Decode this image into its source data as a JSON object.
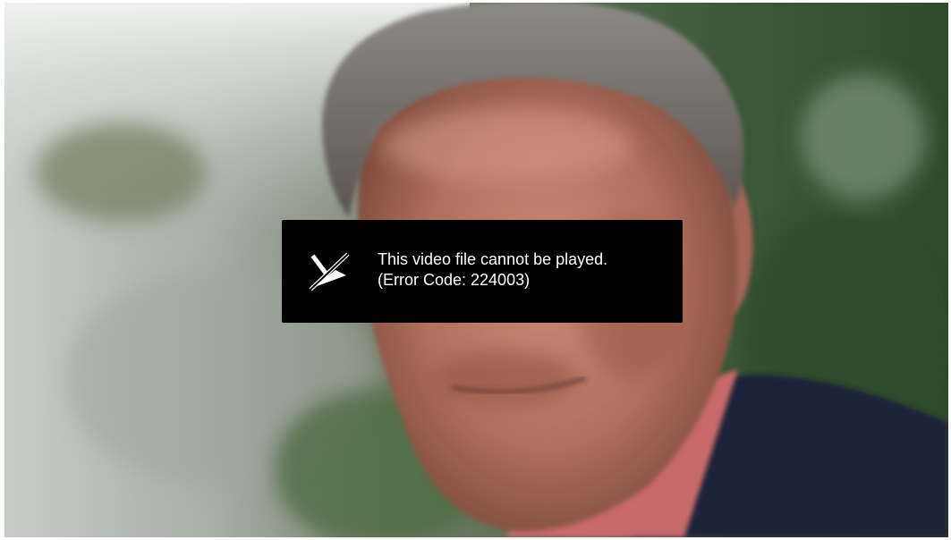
{
  "player": {
    "error": {
      "icon": "video-unavailable-icon",
      "message_line1": "This video file cannot be played.",
      "message_line2": "(Error Code: 224003)"
    }
  },
  "colors": {
    "overlay_background": "#000000",
    "overlay_text": "#ffffff"
  }
}
